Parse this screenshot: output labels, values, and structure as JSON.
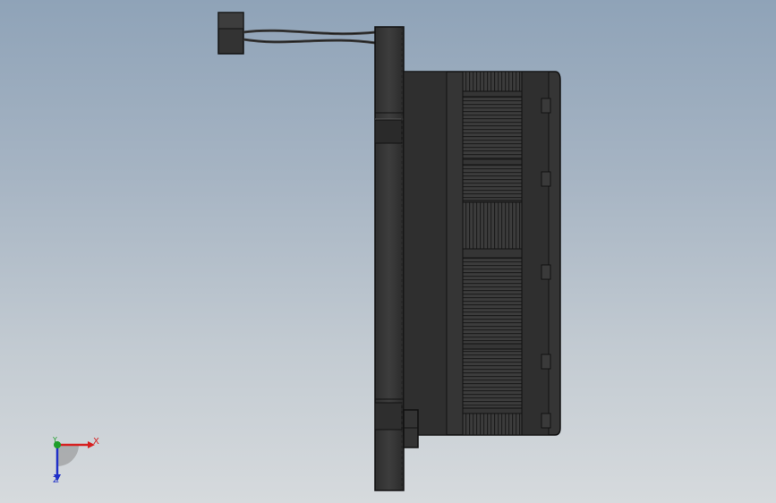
{
  "viewport": {
    "background_top": "#8fa3b8",
    "background_bottom": "#d6dadd",
    "model_color": "#3a3a3a"
  },
  "triad": {
    "x_label": "X",
    "y_label": "Y",
    "z_label": "Z",
    "x_color": "#d62020",
    "y_color": "#1e9e2a",
    "z_color": "#2030c8"
  }
}
